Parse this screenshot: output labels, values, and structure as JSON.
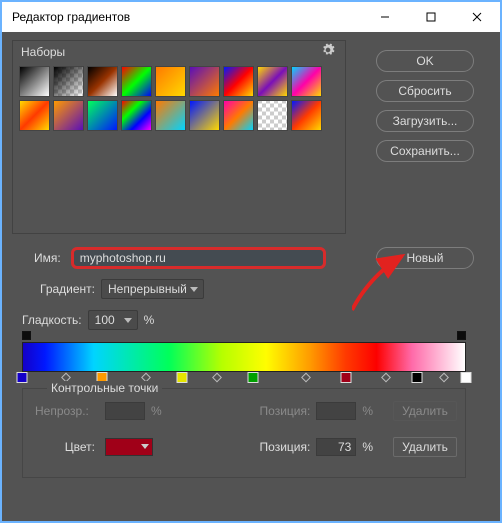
{
  "window": {
    "title": "Редактор градиентов"
  },
  "presets": {
    "label": "Наборы"
  },
  "buttons": {
    "ok": "OK",
    "reset": "Сбросить",
    "load": "Загрузить...",
    "save": "Сохранить...",
    "new": "Новый",
    "delete": "Удалить"
  },
  "name": {
    "label": "Имя:",
    "value": "myphotoshop.ru"
  },
  "gradient_type": {
    "label": "Градиент:",
    "value": "Непрерывный"
  },
  "smoothness": {
    "label": "Гладкость:",
    "value": "100",
    "unit": "%"
  },
  "control_points": {
    "legend": "Контрольные точки",
    "opacity": {
      "label": "Непрозр.:",
      "value": "",
      "unit": "%"
    },
    "position_top": {
      "label": "Позиция:",
      "value": "",
      "unit": "%"
    },
    "color": {
      "label": "Цвет:",
      "hex": "#a00018"
    },
    "position_bottom": {
      "label": "Позиция:",
      "value": "73",
      "unit": "%"
    }
  },
  "color_stops": [
    {
      "pos": 0,
      "color": "#1400c8",
      "kind": "stop"
    },
    {
      "pos": 10,
      "kind": "mid"
    },
    {
      "pos": 18,
      "color": "#ff9a00",
      "kind": "stop"
    },
    {
      "pos": 28,
      "kind": "mid"
    },
    {
      "pos": 36,
      "color": "#e5e500",
      "kind": "stop"
    },
    {
      "pos": 44,
      "kind": "mid"
    },
    {
      "pos": 52,
      "color": "#00a000",
      "kind": "stop"
    },
    {
      "pos": 64,
      "kind": "mid"
    },
    {
      "pos": 73,
      "color": "#a00018",
      "kind": "stop"
    },
    {
      "pos": 82,
      "kind": "mid"
    },
    {
      "pos": 89,
      "color": "#000000",
      "kind": "stop"
    },
    {
      "pos": 95,
      "kind": "mid"
    },
    {
      "pos": 100,
      "color": "#ffffff",
      "kind": "stop"
    }
  ],
  "preset_swatches": [
    "linear-gradient(135deg,#000 0%,#fff 100%)",
    "linear-gradient(135deg,#000 0%,rgba(0,0,0,0) 100%), repeating-conic-gradient(#ccc 0 25%,#fff 0 50%) 0/8px 8px",
    "linear-gradient(135deg,#000 0%,#930 50%,#fff 100%)",
    "linear-gradient(135deg,#f00 0%,#0f0 50%,#00f 100%)",
    "linear-gradient(135deg,#ff7a00 0%,#ffd900 100%)",
    "linear-gradient(135deg,#5a0fb8 0%,#ff7a00 100%)",
    "linear-gradient(135deg,#0018ff 0%,#ff0000 50%,#ffd900 100%)",
    "linear-gradient(135deg,#ffd900 0%,#7a0fb8 50%,#ffd900 100%)",
    "linear-gradient(135deg,#00d4ff 0%,#ff00a8 50%,#ffd900 100%)",
    "linear-gradient(135deg,#ffd900 0%,#ff3a00 50%,#ffd900 100%)",
    "linear-gradient(135deg,#ff9a00 0%,#5a0fb8 100%)",
    "linear-gradient(135deg,#00ff5a 0%,#0018ff 100%)",
    "linear-gradient(135deg,#ff0000 0%,#00ff00 33%,#0000ff 66%,#ff00ff 100%)",
    "linear-gradient(135deg,#ff7a00 0%,#00d4ff 100%)",
    "linear-gradient(135deg,#0018ff 0%,#ffd900 100%)",
    "linear-gradient(135deg,#ff00a8 0%,#ff7a00 50%,#00d4ff 100%)",
    "repeating-conic-gradient(#ccc 0 25%,#fff 0 50%) 0/8px 8px",
    "linear-gradient(135deg,#0018ff 0%,#ff3a00 50%,#ffd900 100%)"
  ]
}
